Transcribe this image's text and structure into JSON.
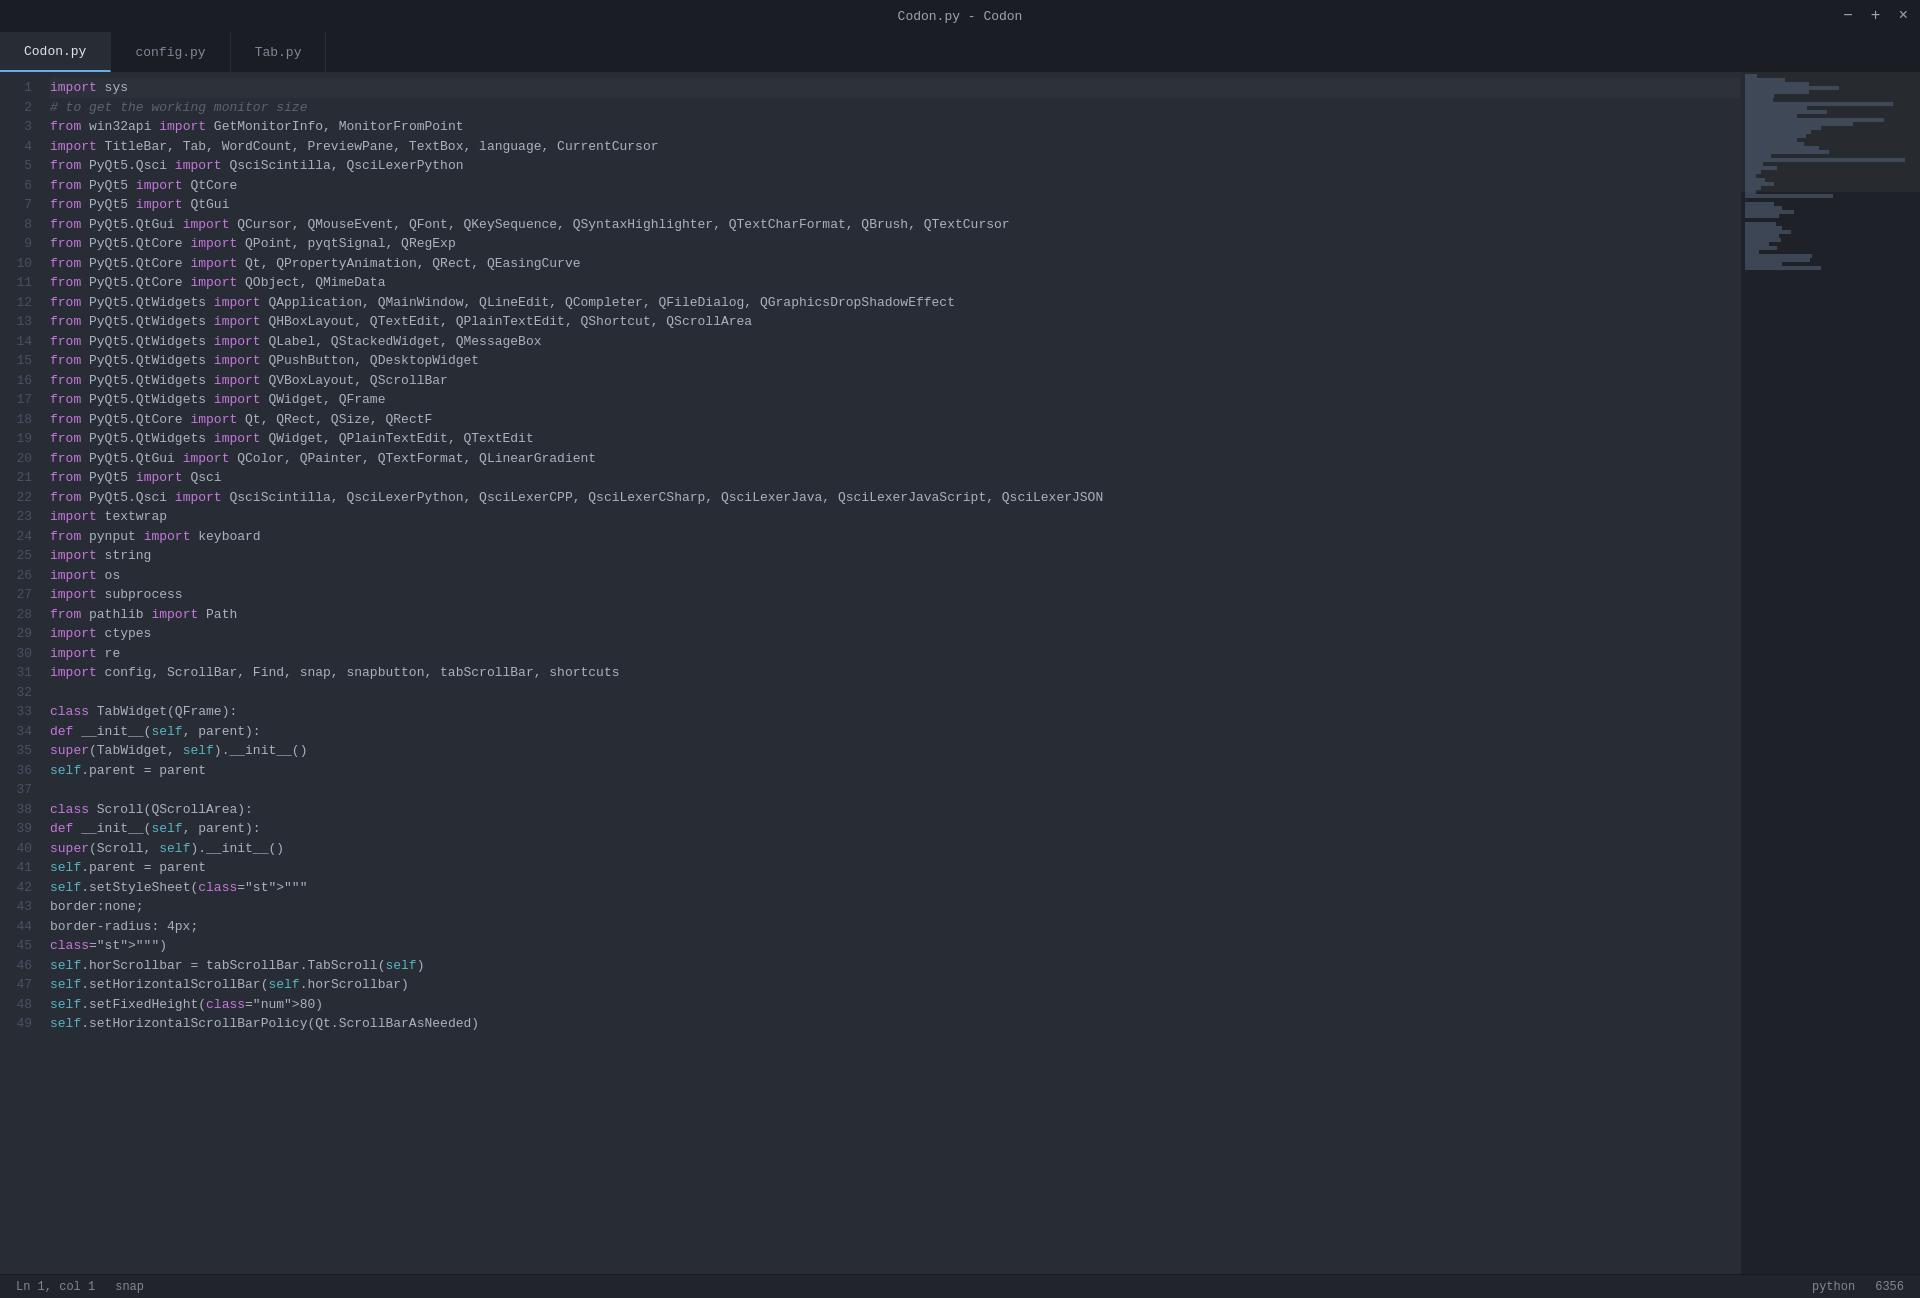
{
  "titleBar": {
    "title": "Codon.py - Codon",
    "minimize": "−",
    "maximize": "+",
    "close": "×"
  },
  "tabs": [
    {
      "id": "codon",
      "label": "Codon.py",
      "active": true
    },
    {
      "id": "config",
      "label": "config.py",
      "active": false
    },
    {
      "id": "tab",
      "label": "Tab.py",
      "active": false
    }
  ],
  "statusBar": {
    "left": {
      "position": "Ln 1, col 1",
      "snap": "snap"
    },
    "right": {
      "language": "python",
      "lineCount": "6356"
    }
  },
  "codeLines": [
    {
      "num": 1,
      "content": "import sys"
    },
    {
      "num": 2,
      "content": "# to get the working monitor size"
    },
    {
      "num": 3,
      "content": "from win32api import GetMonitorInfo, MonitorFromPoint"
    },
    {
      "num": 4,
      "content": "import TitleBar, Tab, WordCount, PreviewPane, TextBox, language, CurrentCursor"
    },
    {
      "num": 5,
      "content": "from PyQt5.Qsci import QsciScintilla, QsciLexerPython"
    },
    {
      "num": 6,
      "content": "from PyQt5 import QtCore"
    },
    {
      "num": 7,
      "content": "from PyQt5 import QtGui"
    },
    {
      "num": 8,
      "content": "from PyQt5.QtGui import QCursor, QMouseEvent, QFont, QKeySequence, QSyntaxHighlighter, QTextCharFormat, QBrush, QTextCursor"
    },
    {
      "num": 9,
      "content": "from PyQt5.QtCore import QPoint, pyqtSignal, QRegExp"
    },
    {
      "num": 10,
      "content": "from PyQt5.QtCore import Qt, QPropertyAnimation, QRect, QEasingCurve"
    },
    {
      "num": 11,
      "content": "from PyQt5.QtCore import QObject, QMimeData"
    },
    {
      "num": 12,
      "content": "from PyQt5.QtWidgets import QApplication, QMainWindow, QLineEdit, QCompleter, QFileDialog, QGraphicsDropShadowEffect"
    },
    {
      "num": 13,
      "content": "from PyQt5.QtWidgets import QHBoxLayout, QTextEdit, QPlainTextEdit, QShortcut, QScrollArea"
    },
    {
      "num": 14,
      "content": "from PyQt5.QtWidgets import QLabel, QStackedWidget, QMessageBox"
    },
    {
      "num": 15,
      "content": "from PyQt5.QtWidgets import QPushButton, QDesktopWidget"
    },
    {
      "num": 16,
      "content": "from PyQt5.QtWidgets import QVBoxLayout, QScrollBar"
    },
    {
      "num": 17,
      "content": "from PyQt5.QtWidgets import QWidget, QFrame"
    },
    {
      "num": 18,
      "content": "from PyQt5.QtCore import Qt, QRect, QSize, QRectF"
    },
    {
      "num": 19,
      "content": "from PyQt5.QtWidgets import QWidget, QPlainTextEdit, QTextEdit"
    },
    {
      "num": 20,
      "content": "from PyQt5.QtGui import QColor, QPainter, QTextFormat, QLinearGradient"
    },
    {
      "num": 21,
      "content": "from PyQt5 import Qsci"
    },
    {
      "num": 22,
      "content": "from PyQt5.Qsci import QsciScintilla, QsciLexerPython, QsciLexerCPP, QsciLexerCSharp, QsciLexerJava, QsciLexerJavaScript, QsciLexerJSON"
    },
    {
      "num": 23,
      "content": "import textwrap"
    },
    {
      "num": 24,
      "content": "from pynput import keyboard"
    },
    {
      "num": 25,
      "content": "import string"
    },
    {
      "num": 26,
      "content": "import os"
    },
    {
      "num": 27,
      "content": "import subprocess"
    },
    {
      "num": 28,
      "content": "from pathlib import Path"
    },
    {
      "num": 29,
      "content": "import ctypes"
    },
    {
      "num": 30,
      "content": "import re"
    },
    {
      "num": 31,
      "content": "import config, ScrollBar, Find, snap, snapbutton, tabScrollBar, shortcuts"
    },
    {
      "num": 32,
      "content": ""
    },
    {
      "num": 33,
      "content": "class TabWidget(QFrame):"
    },
    {
      "num": 34,
      "content": "    def __init__(self, parent):"
    },
    {
      "num": 35,
      "content": "        super(TabWidget, self).__init__()"
    },
    {
      "num": 36,
      "content": "        self.parent = parent"
    },
    {
      "num": 37,
      "content": ""
    },
    {
      "num": 38,
      "content": "class Scroll(QScrollArea):"
    },
    {
      "num": 39,
      "content": "    def __init__(self, parent):"
    },
    {
      "num": 40,
      "content": "        super(Scroll, self).__init__()"
    },
    {
      "num": 41,
      "content": "        self.parent = parent"
    },
    {
      "num": 42,
      "content": "        self.setStyleSheet(\"\"\""
    },
    {
      "num": 43,
      "content": "        border:none;"
    },
    {
      "num": 44,
      "content": "        border-radius: 4px;"
    },
    {
      "num": 45,
      "content": "        \"\"\")"
    },
    {
      "num": 46,
      "content": "        self.horScrollbar = tabScrollBar.TabScroll(self)"
    },
    {
      "num": 47,
      "content": "        self.setHorizontalScrollBar(self.horScrollbar)"
    },
    {
      "num": 48,
      "content": "        self.setFixedHeight(80)"
    },
    {
      "num": 49,
      "content": "        self.setHorizontalScrollBarPolicy(Qt.ScrollBarAsNeeded)"
    }
  ]
}
